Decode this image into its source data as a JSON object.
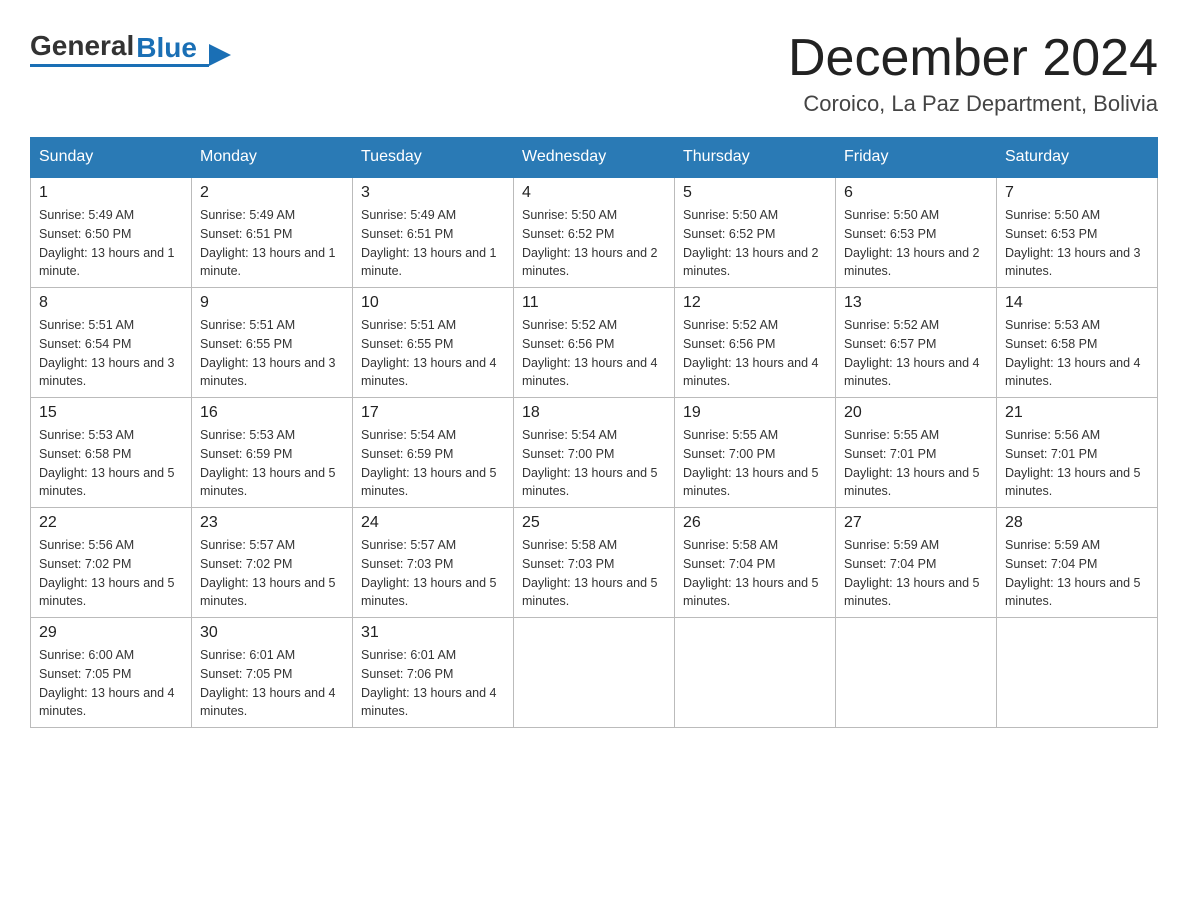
{
  "logo": {
    "general": "General",
    "blue": "Blue",
    "arrow": "▶"
  },
  "header": {
    "month_year": "December 2024",
    "location": "Coroico, La Paz Department, Bolivia"
  },
  "weekdays": [
    "Sunday",
    "Monday",
    "Tuesday",
    "Wednesday",
    "Thursday",
    "Friday",
    "Saturday"
  ],
  "weeks": [
    [
      {
        "day": "1",
        "sunrise": "5:49 AM",
        "sunset": "6:50 PM",
        "daylight": "13 hours and 1 minute."
      },
      {
        "day": "2",
        "sunrise": "5:49 AM",
        "sunset": "6:51 PM",
        "daylight": "13 hours and 1 minute."
      },
      {
        "day": "3",
        "sunrise": "5:49 AM",
        "sunset": "6:51 PM",
        "daylight": "13 hours and 1 minute."
      },
      {
        "day": "4",
        "sunrise": "5:50 AM",
        "sunset": "6:52 PM",
        "daylight": "13 hours and 2 minutes."
      },
      {
        "day": "5",
        "sunrise": "5:50 AM",
        "sunset": "6:52 PM",
        "daylight": "13 hours and 2 minutes."
      },
      {
        "day": "6",
        "sunrise": "5:50 AM",
        "sunset": "6:53 PM",
        "daylight": "13 hours and 2 minutes."
      },
      {
        "day": "7",
        "sunrise": "5:50 AM",
        "sunset": "6:53 PM",
        "daylight": "13 hours and 3 minutes."
      }
    ],
    [
      {
        "day": "8",
        "sunrise": "5:51 AM",
        "sunset": "6:54 PM",
        "daylight": "13 hours and 3 minutes."
      },
      {
        "day": "9",
        "sunrise": "5:51 AM",
        "sunset": "6:55 PM",
        "daylight": "13 hours and 3 minutes."
      },
      {
        "day": "10",
        "sunrise": "5:51 AM",
        "sunset": "6:55 PM",
        "daylight": "13 hours and 4 minutes."
      },
      {
        "day": "11",
        "sunrise": "5:52 AM",
        "sunset": "6:56 PM",
        "daylight": "13 hours and 4 minutes."
      },
      {
        "day": "12",
        "sunrise": "5:52 AM",
        "sunset": "6:56 PM",
        "daylight": "13 hours and 4 minutes."
      },
      {
        "day": "13",
        "sunrise": "5:52 AM",
        "sunset": "6:57 PM",
        "daylight": "13 hours and 4 minutes."
      },
      {
        "day": "14",
        "sunrise": "5:53 AM",
        "sunset": "6:58 PM",
        "daylight": "13 hours and 4 minutes."
      }
    ],
    [
      {
        "day": "15",
        "sunrise": "5:53 AM",
        "sunset": "6:58 PM",
        "daylight": "13 hours and 5 minutes."
      },
      {
        "day": "16",
        "sunrise": "5:53 AM",
        "sunset": "6:59 PM",
        "daylight": "13 hours and 5 minutes."
      },
      {
        "day": "17",
        "sunrise": "5:54 AM",
        "sunset": "6:59 PM",
        "daylight": "13 hours and 5 minutes."
      },
      {
        "day": "18",
        "sunrise": "5:54 AM",
        "sunset": "7:00 PM",
        "daylight": "13 hours and 5 minutes."
      },
      {
        "day": "19",
        "sunrise": "5:55 AM",
        "sunset": "7:00 PM",
        "daylight": "13 hours and 5 minutes."
      },
      {
        "day": "20",
        "sunrise": "5:55 AM",
        "sunset": "7:01 PM",
        "daylight": "13 hours and 5 minutes."
      },
      {
        "day": "21",
        "sunrise": "5:56 AM",
        "sunset": "7:01 PM",
        "daylight": "13 hours and 5 minutes."
      }
    ],
    [
      {
        "day": "22",
        "sunrise": "5:56 AM",
        "sunset": "7:02 PM",
        "daylight": "13 hours and 5 minutes."
      },
      {
        "day": "23",
        "sunrise": "5:57 AM",
        "sunset": "7:02 PM",
        "daylight": "13 hours and 5 minutes."
      },
      {
        "day": "24",
        "sunrise": "5:57 AM",
        "sunset": "7:03 PM",
        "daylight": "13 hours and 5 minutes."
      },
      {
        "day": "25",
        "sunrise": "5:58 AM",
        "sunset": "7:03 PM",
        "daylight": "13 hours and 5 minutes."
      },
      {
        "day": "26",
        "sunrise": "5:58 AM",
        "sunset": "7:04 PM",
        "daylight": "13 hours and 5 minutes."
      },
      {
        "day": "27",
        "sunrise": "5:59 AM",
        "sunset": "7:04 PM",
        "daylight": "13 hours and 5 minutes."
      },
      {
        "day": "28",
        "sunrise": "5:59 AM",
        "sunset": "7:04 PM",
        "daylight": "13 hours and 5 minutes."
      }
    ],
    [
      {
        "day": "29",
        "sunrise": "6:00 AM",
        "sunset": "7:05 PM",
        "daylight": "13 hours and 4 minutes."
      },
      {
        "day": "30",
        "sunrise": "6:01 AM",
        "sunset": "7:05 PM",
        "daylight": "13 hours and 4 minutes."
      },
      {
        "day": "31",
        "sunrise": "6:01 AM",
        "sunset": "7:06 PM",
        "daylight": "13 hours and 4 minutes."
      },
      null,
      null,
      null,
      null
    ]
  ],
  "labels": {
    "sunrise_prefix": "Sunrise: ",
    "sunset_prefix": "Sunset: ",
    "daylight_prefix": "Daylight: "
  }
}
